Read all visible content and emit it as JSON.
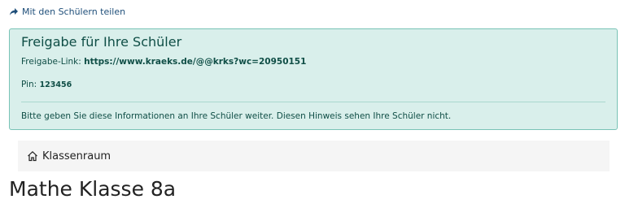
{
  "share": {
    "label": "Mit den Schülern teilen",
    "icon": "share-icon"
  },
  "info_box": {
    "title": "Freigabe für Ihre Schüler",
    "link_label": "Freigabe-Link:",
    "link_value": "https://www.kraeks.de/@@krks?wc=20950151",
    "pin_label": "Pin:",
    "pin_value": "123456",
    "note": "Bitte geben Sie diese Informationen an Ihre Schüler weiter. Diesen Hinweis sehen Ihre Schüler nicht.",
    "colors": {
      "background": "#d9efeb",
      "border": "#79c3b6",
      "text": "#0f4e46"
    }
  },
  "breadcrumb": {
    "icon": "home-icon",
    "label": "Klassenraum"
  },
  "page": {
    "title": "Mathe Klasse 8a"
  }
}
